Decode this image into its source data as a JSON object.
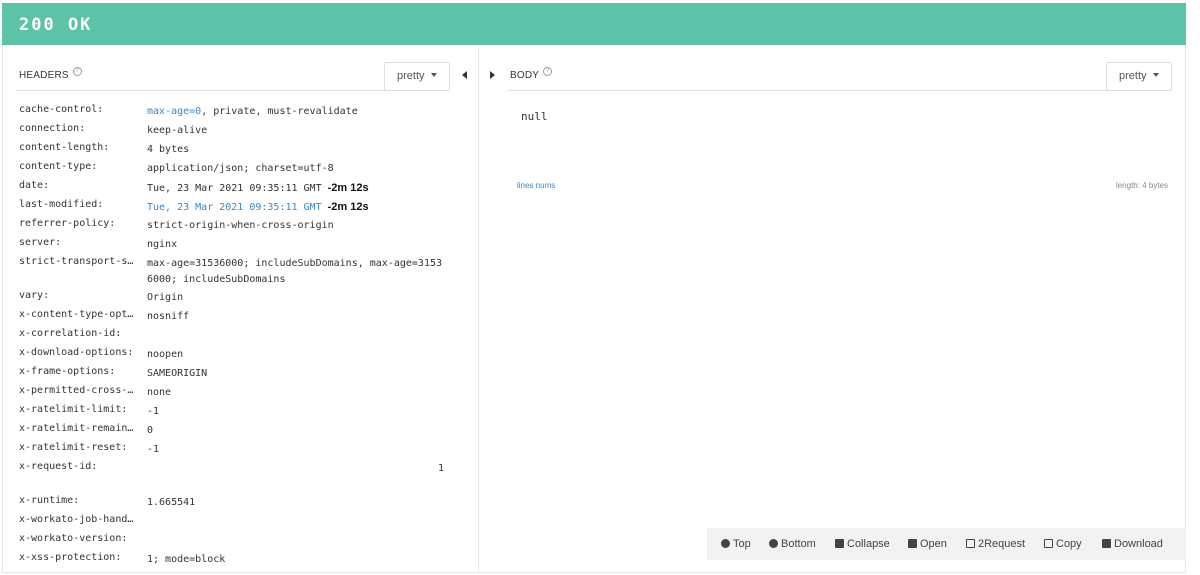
{
  "status": {
    "text": "200 OK",
    "color": "#5cc3a9"
  },
  "headers_panel": {
    "title": "HEADERS",
    "help": "?",
    "pretty_label": "pretty",
    "rows": [
      {
        "key": "cache-control:",
        "value_link": "max-age=0",
        "value": ", private, must-revalidate"
      },
      {
        "key": "connection:",
        "value": "keep-alive"
      },
      {
        "key": "content-length:",
        "value": "4 bytes"
      },
      {
        "key": "content-type:",
        "value": "application/json; charset=utf-8"
      },
      {
        "key": "date:",
        "value": "Tue, 23 Mar 2021 09:35:11 GMT",
        "rel": "-2m 12s"
      },
      {
        "key": "last-modified:",
        "value_link": "Tue, 23 Mar 2021 09:35:11 GMT",
        "rel": "-2m 12s"
      },
      {
        "key": "referrer-policy:",
        "value": "strict-origin-when-cross-origin"
      },
      {
        "key": "server:",
        "value": "nginx"
      },
      {
        "key": "strict-transport-s…",
        "value": "max-age=31536000; includeSubDomains, max-age=31536000; includeSubDomains"
      },
      {
        "key": "vary:",
        "value": "Origin"
      },
      {
        "key": "x-content-type-opt…",
        "value": "nosniff"
      },
      {
        "key": "x-correlation-id:",
        "value": ""
      },
      {
        "key": "x-download-options:",
        "value": "noopen"
      },
      {
        "key": "x-frame-options:",
        "value": "SAMEORIGIN"
      },
      {
        "key": "x-permitted-cross-…",
        "value": "none"
      },
      {
        "key": "x-ratelimit-limit:",
        "value": "-1"
      },
      {
        "key": "x-ratelimit-remain…",
        "value": "0"
      },
      {
        "key": "x-ratelimit-reset:",
        "value": "-1"
      },
      {
        "key": "x-request-id:",
        "value_right": "1"
      },
      {
        "key": "x-runtime:",
        "value": "1.665541"
      },
      {
        "key": "x-workato-job-hand…",
        "value": ""
      },
      {
        "key": "x-workato-version:",
        "value": ""
      },
      {
        "key": "x-xss-protection:",
        "value": "1; mode=block"
      }
    ]
  },
  "body_panel": {
    "title": "BODY",
    "help": "?",
    "pretty_label": "pretty",
    "content": "null",
    "lines_nums": "lines nums",
    "length": "length: 4 bytes"
  },
  "toolbar": {
    "top": "Top",
    "bottom": "Bottom",
    "collapse": "Collapse",
    "open": "Open",
    "to_request": "2Request",
    "copy": "Copy",
    "download": "Download"
  }
}
